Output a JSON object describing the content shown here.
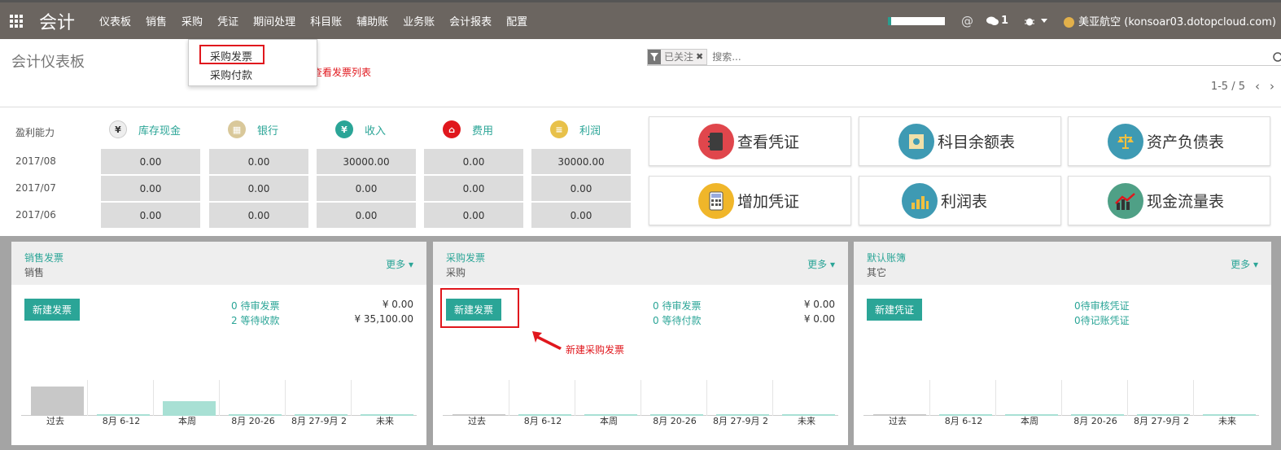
{
  "navbar": {
    "brand": "会计",
    "menu": [
      "仪表板",
      "销售",
      "采购",
      "凭证",
      "期间处理",
      "科目账",
      "辅助账",
      "业务账",
      "会计报表",
      "配置"
    ],
    "at_symbol": "@",
    "chat_count": "1",
    "user": "美亚航空 (konsoar03.dotopcloud.com)"
  },
  "dropdown": {
    "items": [
      "采购发票",
      "采购付款"
    ],
    "annotation": "查看发票列表"
  },
  "breadcrumb": "会计仪表板",
  "search": {
    "facet_label": "已关注",
    "placeholder": "搜索..."
  },
  "pager": {
    "text": "1-5 / 5"
  },
  "profit": {
    "label": "盈利能力",
    "columns": [
      "库存现金",
      "银行",
      "收入",
      "费用",
      "利润"
    ],
    "column_icon_colors": [
      "#e9e9e9",
      "#d9c89a",
      "#2ba597",
      "#e0171d",
      "#e8c14a"
    ],
    "rows": [
      {
        "period": "2017/08",
        "values": [
          "0.00",
          "0.00",
          "30000.00",
          "0.00",
          "30000.00"
        ]
      },
      {
        "period": "2017/07",
        "values": [
          "0.00",
          "0.00",
          "0.00",
          "0.00",
          "0.00"
        ]
      },
      {
        "period": "2017/06",
        "values": [
          "0.00",
          "0.00",
          "0.00",
          "0.00",
          "0.00"
        ]
      }
    ]
  },
  "quick_buttons": [
    {
      "label": "查看凭证",
      "icon": "notebook-icon",
      "color": "#e0464c"
    },
    {
      "label": "科目余额表",
      "icon": "ledger-icon",
      "color": "#3e9ab3"
    },
    {
      "label": "资产负债表",
      "icon": "balance-scale-icon",
      "color": "#3e9ab3"
    },
    {
      "label": "增加凭证",
      "icon": "calculator-icon",
      "color": "#f0b62a"
    },
    {
      "label": "利润表",
      "icon": "bar-chart-icon",
      "color": "#3e9ab3"
    },
    {
      "label": "现金流量表",
      "icon": "trend-icon",
      "color": "#4fa086"
    }
  ],
  "cards": [
    {
      "title": "销售发票",
      "subtitle": "销售",
      "more": "更多",
      "button": "新建发票",
      "links": [
        "0 待审发票",
        "2 等待收款"
      ],
      "amounts": [
        "¥ 0.00",
        "¥ 35,100.00"
      ],
      "x_labels": [
        "过去",
        "8月 6-12",
        "本周",
        "8月 20-26",
        "8月 27-9月 2",
        "未来"
      ],
      "bars": [
        1.0,
        0.03,
        0.5,
        0.03,
        0.03,
        0.03
      ]
    },
    {
      "title": "采购发票",
      "subtitle": "采购",
      "more": "更多",
      "button": "新建发票",
      "links": [
        "0 待审发票",
        "0 等待付款"
      ],
      "amounts": [
        "¥ 0.00",
        "¥ 0.00"
      ],
      "x_labels": [
        "过去",
        "8月 6-12",
        "本周",
        "8月 20-26",
        "8月 27-9月 2",
        "未来"
      ],
      "bars": [
        0.03,
        0.03,
        0.03,
        0.03,
        0.03,
        0.03
      ],
      "annotation": "新建采购发票"
    },
    {
      "title": "默认账簿",
      "subtitle": "其它",
      "more": "更多",
      "button": "新建凭证",
      "links": [
        "0待审核凭证",
        "0待记账凭证"
      ],
      "amounts": [],
      "x_labels": [
        "过去",
        "8月 6-12",
        "本周",
        "8月 20-26",
        "8月 27-9月 2",
        "未来"
      ],
      "bars": [
        0.03,
        0.03,
        0.03,
        0.03,
        0.03,
        0.03
      ]
    }
  ]
}
